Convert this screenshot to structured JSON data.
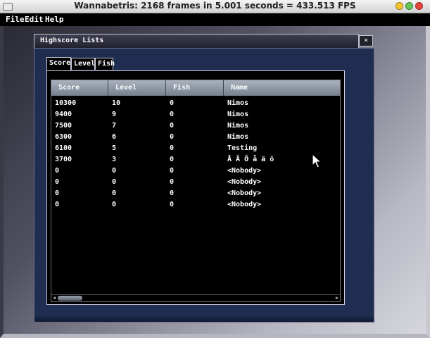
{
  "window": {
    "title": "Wannabetris: 2168 frames in 5.001 seconds = 433.513 FPS",
    "button_colors": [
      "#f5c52c",
      "#62c554",
      "#e8453c"
    ]
  },
  "menubar": {
    "items": [
      "File",
      "Edit",
      "Help"
    ]
  },
  "dialog": {
    "title": "Highscore Lists",
    "close_icon": "×",
    "tabs": [
      {
        "label": "Score",
        "active": true
      },
      {
        "label": "Level",
        "active": false
      },
      {
        "label": "Fish",
        "active": false
      }
    ],
    "columns": [
      "Score",
      "Level",
      "Fish",
      "Name"
    ],
    "rows": [
      {
        "score": "10300",
        "level": "10",
        "fish": "0",
        "name": "Nimos"
      },
      {
        "score": "9400",
        "level": "9",
        "fish": "0",
        "name": "Nimos"
      },
      {
        "score": "7500",
        "level": "7",
        "fish": "0",
        "name": "Nimos"
      },
      {
        "score": "6300",
        "level": "6",
        "fish": "0",
        "name": "Nimos"
      },
      {
        "score": "6100",
        "level": "5",
        "fish": "0",
        "name": "Testing"
      },
      {
        "score": "3700",
        "level": "3",
        "fish": "0",
        "name": "Å Ä Ö å ä ö"
      },
      {
        "score": "0",
        "level": "0",
        "fish": "0",
        "name": "<Nobody>"
      },
      {
        "score": "0",
        "level": "0",
        "fish": "0",
        "name": "<Nobody>"
      },
      {
        "score": "0",
        "level": "0",
        "fish": "0",
        "name": "<Nobody>"
      },
      {
        "score": "0",
        "level": "0",
        "fish": "0",
        "name": "<Nobody>"
      }
    ],
    "scroll_left_icon": "◀",
    "scroll_right_icon": "▶"
  }
}
